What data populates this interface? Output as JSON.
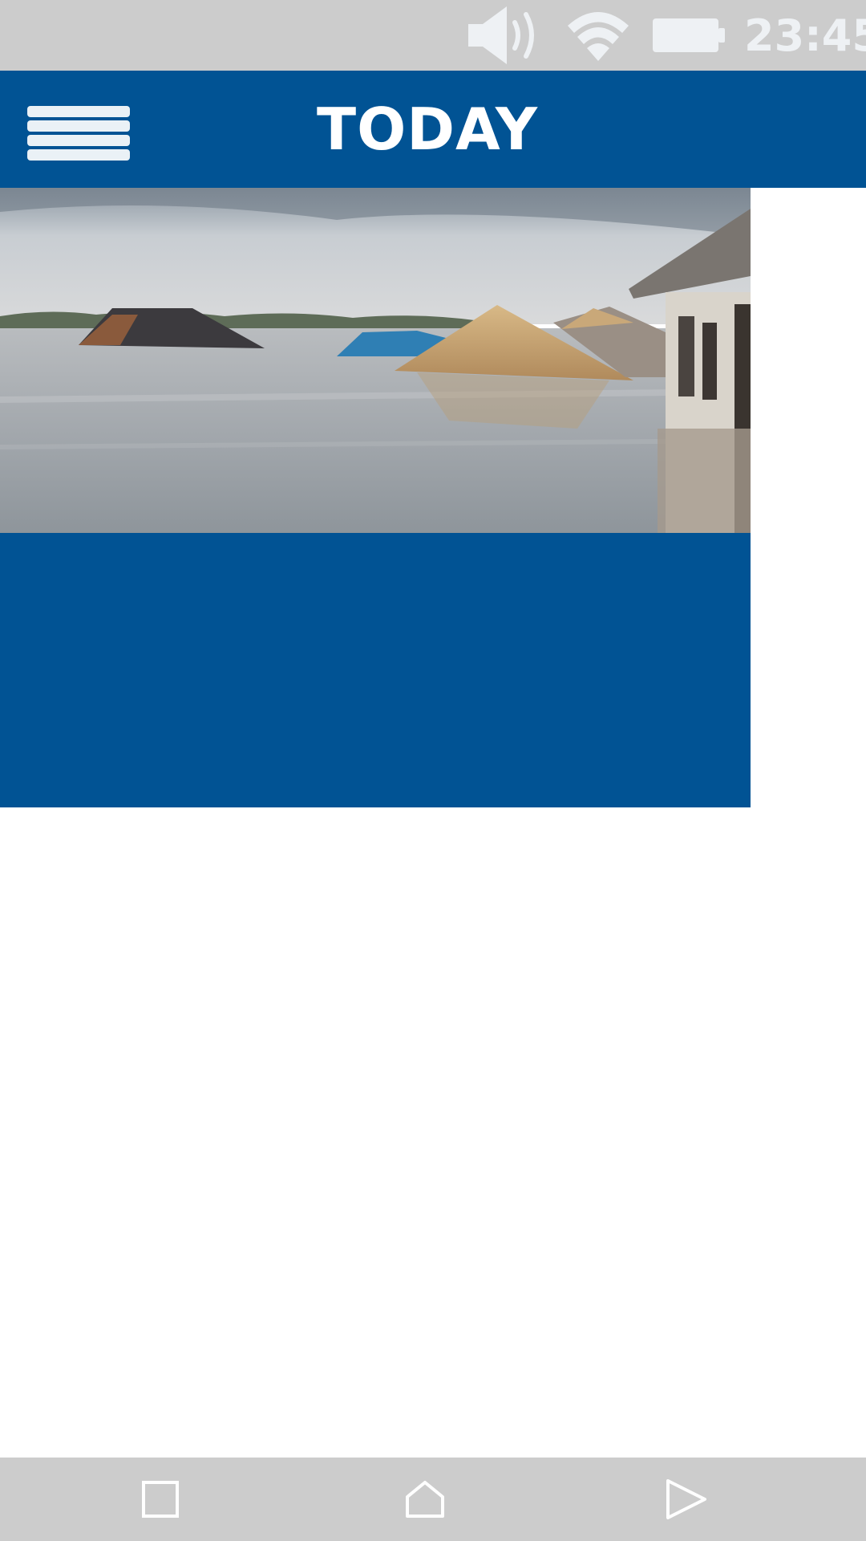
{
  "status_bar": {
    "time": "23:45",
    "icons": [
      "speaker-icon",
      "wifi-icon",
      "battery-icon"
    ],
    "color": "#cccccc"
  },
  "app_bar": {
    "title": "TODAY",
    "menu_icon": "hamburger-menu-icon",
    "color": "#015394"
  },
  "story": {
    "image": "flooded-houses-photo",
    "panel_color": "#015394"
  },
  "nav_bar": {
    "icons": [
      "recents-square-icon",
      "home-icon",
      "back-triangle-icon"
    ]
  }
}
